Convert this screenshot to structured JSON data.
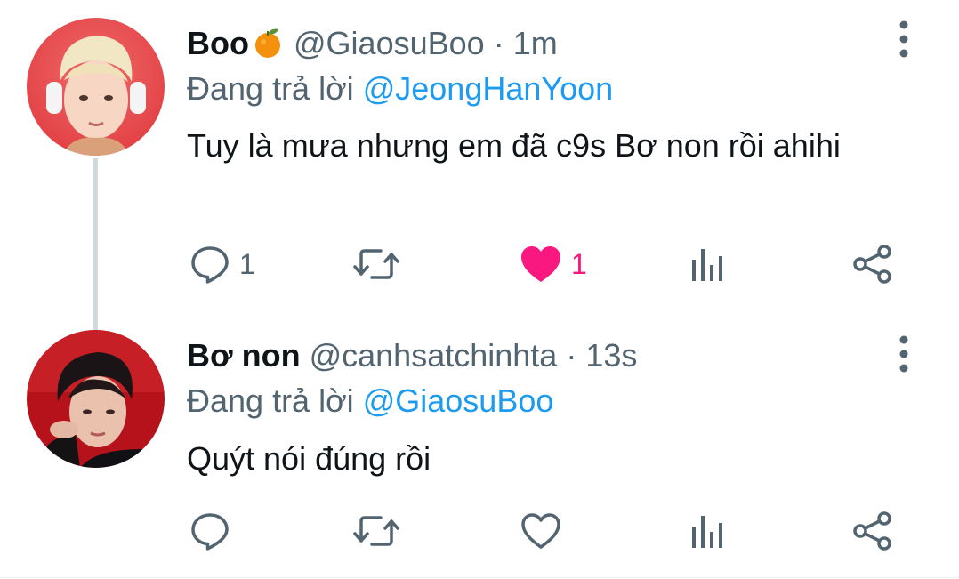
{
  "colors": {
    "accent": "#1d9bf0",
    "secondary_text": "#536471",
    "like_active": "#f91880",
    "thread_line": "#cfd9de"
  },
  "tweets": [
    {
      "name": "Boo",
      "name_emoji": "tangerine-emoji",
      "handle": "@GiaosuBoo",
      "separator": "·",
      "time": "1m",
      "replying_prefix": "Đang trả lời",
      "replying_to": "@JeongHanYoon",
      "text": "Tuy là mưa nhưng em đã c9s Bơ non rồi ahihi",
      "reply_count": "1",
      "like_count": "1",
      "liked": true,
      "icons": [
        "reply-icon",
        "retweet-icon",
        "like-icon-filled",
        "analytics-icon",
        "share-icon",
        "more-vertical-icon"
      ]
    },
    {
      "name": "Bơ non",
      "handle": "@canhsatchinhta",
      "separator": "·",
      "time": "13s",
      "replying_prefix": "Đang trả lời",
      "replying_to": "@GiaosuBoo",
      "text": "Quýt nói đúng rồi",
      "reply_count": "",
      "like_count": "",
      "liked": false,
      "icons": [
        "reply-icon",
        "retweet-icon",
        "like-icon",
        "analytics-icon",
        "share-icon",
        "more-vertical-icon"
      ]
    }
  ]
}
